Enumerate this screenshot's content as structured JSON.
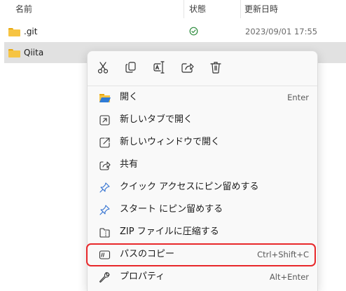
{
  "columns": {
    "name": "名前",
    "status": "状態",
    "modified": "更新日時"
  },
  "files": [
    {
      "name": ".git",
      "status_icon": "sync-ok-icon",
      "modified": "2023/09/01 17:55"
    },
    {
      "name": "Qiita",
      "status_icon": "",
      "modified": ""
    }
  ],
  "context_menu": {
    "quick_actions": [
      "cut-icon",
      "copy-icon",
      "rename-icon",
      "share-icon",
      "delete-icon"
    ],
    "items": [
      {
        "label": "開く",
        "shortcut": "Enter",
        "icon": "folder-open-icon"
      },
      {
        "label": "新しいタブで開く",
        "shortcut": "",
        "icon": "new-tab-icon"
      },
      {
        "label": "新しいウィンドウで開く",
        "shortcut": "",
        "icon": "new-window-icon"
      },
      {
        "label": "共有",
        "shortcut": "",
        "icon": "share-icon"
      },
      {
        "label": "クイック アクセスにピン留めする",
        "shortcut": "",
        "icon": "pin-icon"
      },
      {
        "label": "スタート にピン留めする",
        "shortcut": "",
        "icon": "pin-icon"
      },
      {
        "label": "ZIP ファイルに圧縮する",
        "shortcut": "",
        "icon": "zip-icon"
      },
      {
        "label": "パスのコピー",
        "shortcut": "Ctrl+Shift+C",
        "icon": "copy-path-icon"
      },
      {
        "label": "プロパティ",
        "shortcut": "Alt+Enter",
        "icon": "wrench-icon"
      }
    ]
  },
  "colors": {
    "highlight_border": "#e8282b",
    "folder": "#f6c443",
    "status_ok": "#2a8a3a",
    "selected_row": "#e1e1e1"
  }
}
